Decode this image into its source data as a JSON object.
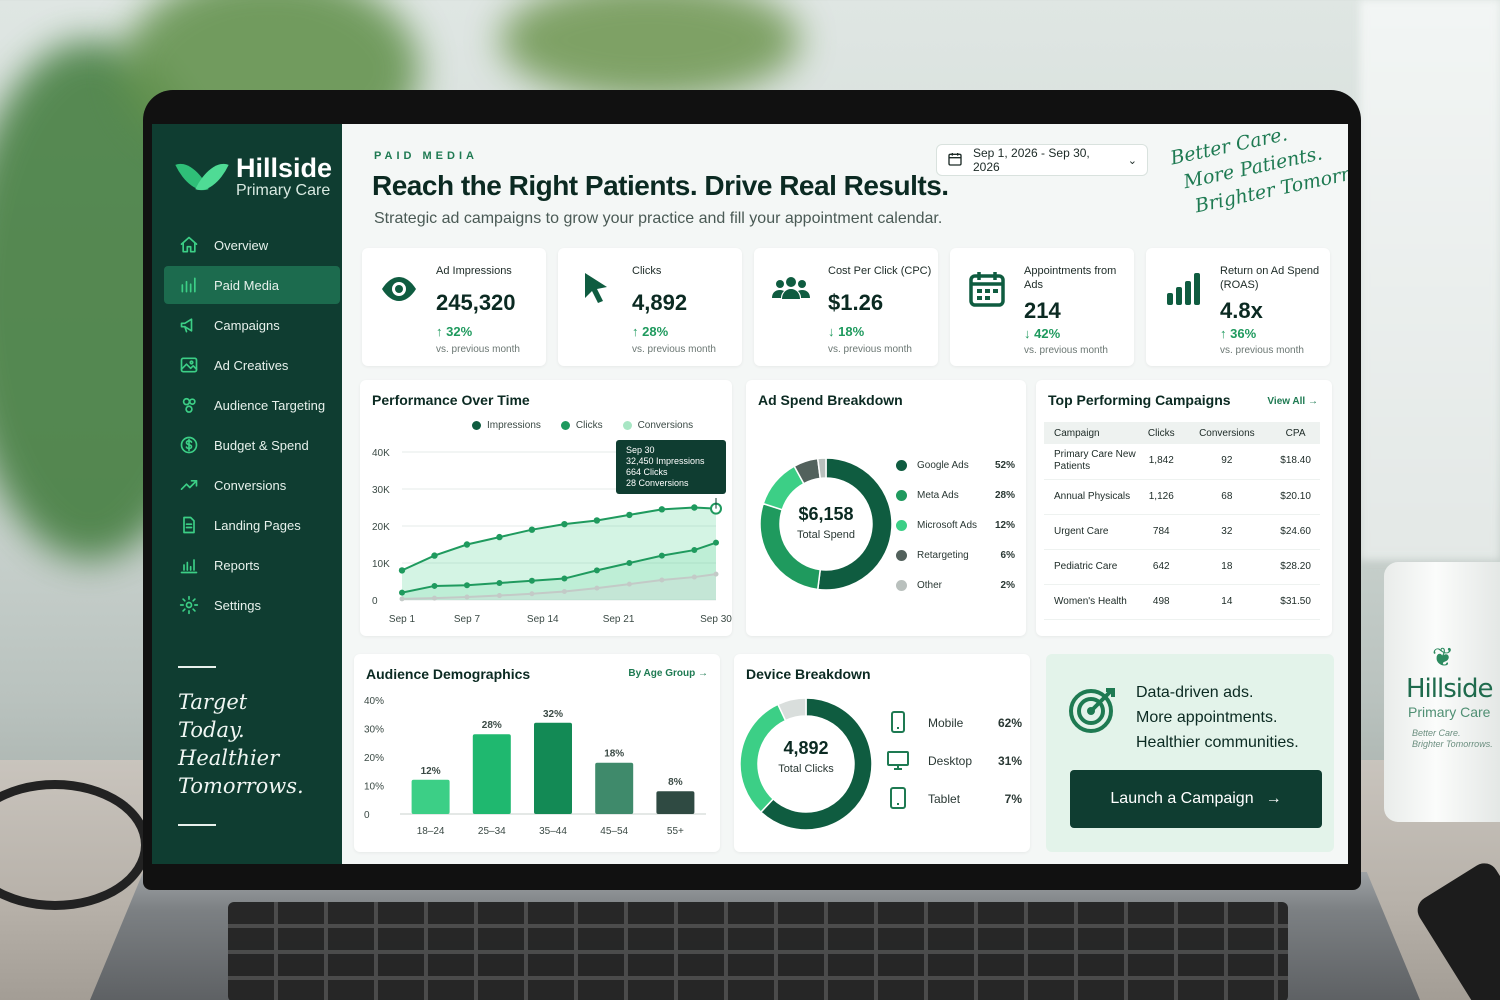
{
  "brand": {
    "name": "Hillside",
    "subtitle": "Primary Care"
  },
  "sidebar": {
    "items": [
      {
        "label": "Overview",
        "icon": "home-icon",
        "active": false
      },
      {
        "label": "Paid Media",
        "icon": "bar-chart-icon",
        "active": true
      },
      {
        "label": "Campaigns",
        "icon": "megaphone-icon",
        "active": false
      },
      {
        "label": "Ad Creatives",
        "icon": "image-icon",
        "active": false
      },
      {
        "label": "Audience Targeting",
        "icon": "users-icon",
        "active": false
      },
      {
        "label": "Budget & Spend",
        "icon": "dollar-circle-icon",
        "active": false
      },
      {
        "label": "Conversions",
        "icon": "trend-up-icon",
        "active": false
      },
      {
        "label": "Landing Pages",
        "icon": "document-icon",
        "active": false
      },
      {
        "label": "Reports",
        "icon": "reports-icon",
        "active": false
      },
      {
        "label": "Settings",
        "icon": "gear-icon",
        "active": false
      }
    ],
    "quote": [
      "Target",
      "Today.",
      "Healthier",
      "Tomorrows."
    ]
  },
  "header": {
    "eyebrow": "PAID MEDIA",
    "title": "Reach the Right Patients. Drive Real Results.",
    "subtitle": "Strategic ad campaigns to grow your practice and fill your appointment calendar.",
    "date_range": "Sep 1, 2026 - Sep 30, 2026",
    "tagline": [
      "Better Care.",
      "More Patients.",
      "Brighter Tomorrows."
    ]
  },
  "kpis": [
    {
      "label": "Ad Impressions",
      "value": "245,320",
      "change": "32%",
      "direction": "up",
      "note": "vs. previous month",
      "icon": "eye-icon"
    },
    {
      "label": "Clicks",
      "value": "4,892",
      "change": "28%",
      "direction": "up",
      "note": "vs. previous month",
      "icon": "cursor-icon"
    },
    {
      "label": "Cost Per Click (CPC)",
      "value": "$1.26",
      "change": "18%",
      "direction": "down",
      "note": "vs. previous month",
      "icon": "users-icon"
    },
    {
      "label": "Appointments from Ads",
      "value": "214",
      "change": "42%",
      "direction": "down",
      "note": "vs. previous month",
      "icon": "calendar-icon"
    },
    {
      "label": "Return on Ad Spend (ROAS)",
      "value": "4.8x",
      "change": "36%",
      "direction": "up",
      "note": "vs. previous month",
      "icon": "bars-icon"
    }
  ],
  "colors": {
    "primary": "#0f3d31",
    "accent": "#1e7a52",
    "bright": "#3ccf86",
    "light": "#a8e6c4",
    "gray": "#b9c0bd"
  },
  "performance": {
    "title": "Performance Over Time",
    "tooltip": {
      "date": "Sep 30",
      "lines": [
        "32,450 Impressions",
        "664 Clicks",
        "28 Conversions"
      ]
    }
  },
  "spend": {
    "title": "Ad Spend Breakdown",
    "total_value": "$6,158",
    "total_label": "Total Spend",
    "items": [
      {
        "name": "Google Ads",
        "pct": "52%",
        "value": 52,
        "color": "#0f5c40"
      },
      {
        "name": "Meta Ads",
        "pct": "28%",
        "value": 28,
        "color": "#1f9a5e"
      },
      {
        "name": "Microsoft Ads",
        "pct": "12%",
        "value": 12,
        "color": "#3ccf86"
      },
      {
        "name": "Retargeting",
        "pct": "6%",
        "value": 6,
        "color": "#52615c"
      },
      {
        "name": "Other",
        "pct": "2%",
        "value": 2,
        "color": "#b9c0bd"
      }
    ]
  },
  "campaigns": {
    "title": "Top Performing Campaigns",
    "view_all": "View All",
    "headers": [
      "Campaign",
      "Clicks",
      "Conversions",
      "CPA"
    ],
    "rows": [
      [
        "Primary Care New Patients",
        "1,842",
        "92",
        "$18.40"
      ],
      [
        "Annual Physicals",
        "1,126",
        "68",
        "$20.10"
      ],
      [
        "Urgent Care",
        "784",
        "32",
        "$24.60"
      ],
      [
        "Pediatric Care",
        "642",
        "18",
        "$28.20"
      ],
      [
        "Women's Health",
        "498",
        "14",
        "$31.50"
      ]
    ]
  },
  "audience": {
    "title": "Audience Demographics",
    "link": "By Age Group"
  },
  "devices": {
    "title": "Device Breakdown",
    "total_value": "4,892",
    "total_label": "Total Clicks",
    "items": [
      {
        "name": "Mobile",
        "pct": "62%",
        "value": 62,
        "icon": "smartphone-icon",
        "color": "#0f5c40"
      },
      {
        "name": "Desktop",
        "pct": "31%",
        "value": 31,
        "icon": "monitor-icon",
        "color": "#3ccf86"
      },
      {
        "name": "Tablet",
        "pct": "7%",
        "value": 7,
        "icon": "tablet-icon",
        "color": "#d9dedc"
      }
    ]
  },
  "cta": {
    "lines": [
      "Data-driven ads.",
      "More appointments.",
      "Healthier communities."
    ],
    "button": "Launch a Campaign"
  },
  "mug": {
    "brand": "Hillside",
    "subtitle": "Primary Care",
    "tagline": [
      "Better Care.",
      "Brighter Tomorrows."
    ]
  },
  "chart_data": [
    {
      "type": "area",
      "x": [
        "Sep 1",
        "Sep 7",
        "Sep 14",
        "Sep 21",
        "Sep 30"
      ],
      "xticks": [
        "Sep 1",
        "Sep 7",
        "Sep 14",
        "Sep 21",
        "Sep 30"
      ],
      "ylim": [
        0,
        40000
      ],
      "yticks": [
        "0",
        "10K",
        "20K",
        "30K",
        "40K"
      ],
      "series": [
        {
          "name": "Impressions",
          "color": "#1f9a5e",
          "x": [
            1,
            4,
            7,
            10,
            13,
            16,
            19,
            22,
            25,
            28,
            30
          ],
          "values": [
            8000,
            12000,
            15000,
            17000,
            19000,
            20500,
            21500,
            23000,
            24500,
            25000,
            24700
          ]
        },
        {
          "name": "Clicks",
          "color": "#3ccf86",
          "x": [
            1,
            4,
            7,
            10,
            13,
            16,
            19,
            22,
            25,
            28,
            30
          ],
          "values": [
            2000,
            3800,
            4000,
            4600,
            5200,
            5800,
            8000,
            10000,
            12000,
            13500,
            15500
          ]
        },
        {
          "name": "Conversions",
          "color": "#b9c0bd",
          "x": [
            1,
            4,
            7,
            10,
            13,
            16,
            19,
            22,
            25,
            28,
            30
          ],
          "values": [
            300,
            500,
            800,
            1200,
            1700,
            2300,
            3200,
            4300,
            5400,
            6200,
            7000
          ]
        }
      ]
    },
    {
      "type": "pie",
      "categories": [
        "Google Ads",
        "Meta Ads",
        "Microsoft Ads",
        "Retargeting",
        "Other"
      ],
      "values": [
        52,
        28,
        12,
        6,
        2
      ]
    },
    {
      "type": "bar",
      "categories": [
        "18–24",
        "25–34",
        "35–44",
        "45–54",
        "55+"
      ],
      "values": [
        12,
        28,
        32,
        18,
        8
      ],
      "labels": [
        "12%",
        "28%",
        "32%",
        "18%",
        "8%"
      ],
      "colors": [
        "#3ccf86",
        "#1fb86f",
        "#138a55",
        "#3f8a6b",
        "#2f4a42"
      ],
      "ylim": [
        0,
        40
      ],
      "yticks": [
        "0",
        "10%",
        "20%",
        "30%",
        "40%"
      ]
    },
    {
      "type": "pie",
      "categories": [
        "Mobile",
        "Desktop",
        "Tablet"
      ],
      "values": [
        62,
        31,
        7
      ]
    }
  ]
}
